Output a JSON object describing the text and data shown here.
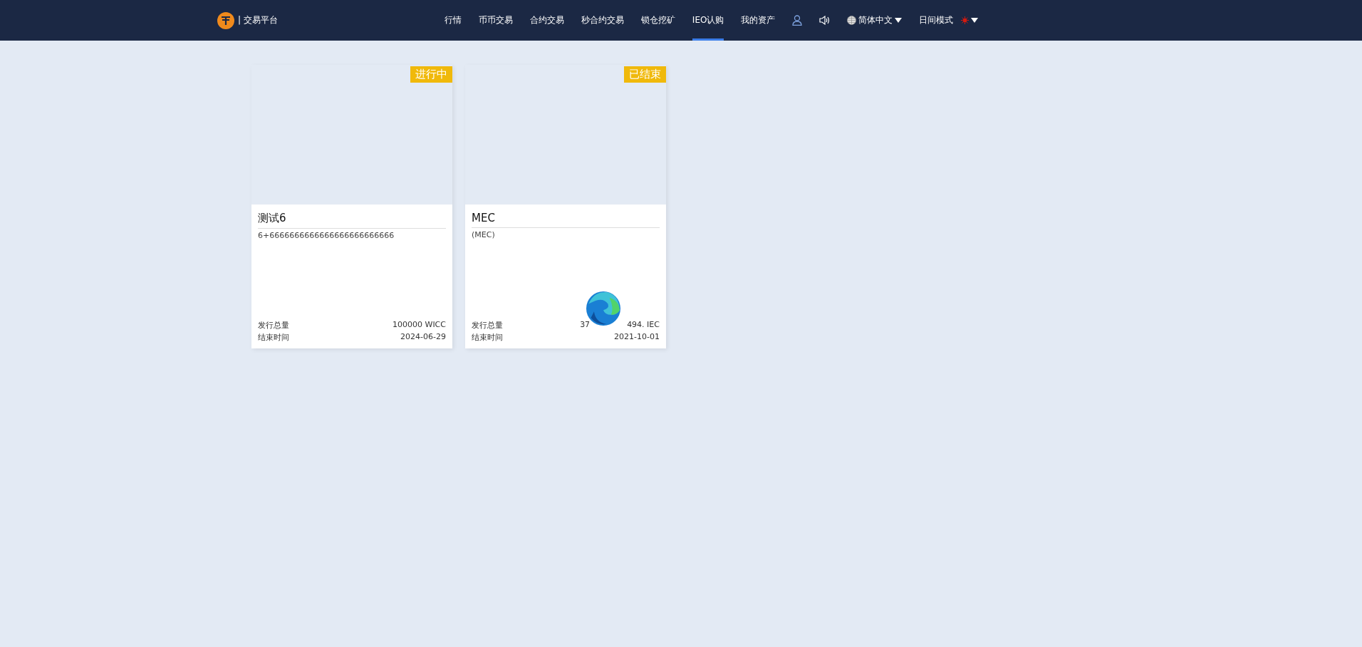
{
  "header": {
    "logo_text": "| 交易平台",
    "nav": [
      {
        "label": "行情",
        "selected": false
      },
      {
        "label": "币币交易",
        "selected": false
      },
      {
        "label": "合约交易",
        "selected": false
      },
      {
        "label": "秒合约交易",
        "selected": false
      },
      {
        "label": "锁仓挖矿",
        "selected": false
      },
      {
        "label": "IEO认购",
        "selected": true
      },
      {
        "label": "我的资产",
        "selected": false
      }
    ],
    "language": "简体中文",
    "theme": "日间模式"
  },
  "projects": [
    {
      "status": "进行中",
      "title": "测试6",
      "subtitle": "6+6666666666666666666666666",
      "rows": [
        {
          "label": "发行总量",
          "value": [
            "100000 WICC"
          ]
        },
        {
          "label": "结束时间",
          "value": [
            "2024-06-29"
          ]
        }
      ],
      "overlay": false
    },
    {
      "status": "已结束",
      "title": "MEC",
      "subtitle": "(MEC)",
      "rows": [
        {
          "label": "发行总量",
          "value": [
            "37",
            "494. IEC"
          ]
        },
        {
          "label": "结束时间",
          "value": [
            "2021-10-01"
          ]
        }
      ],
      "overlay": true
    }
  ]
}
